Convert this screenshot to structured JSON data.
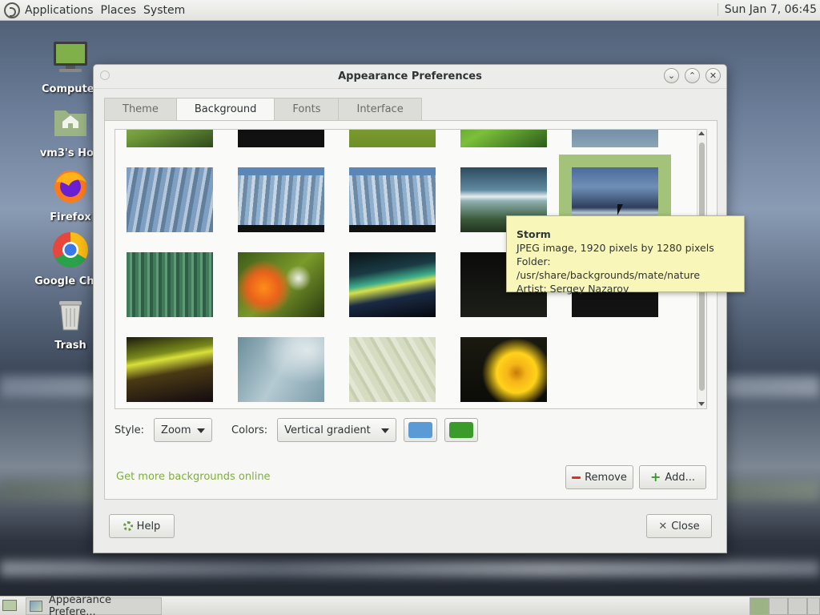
{
  "top_panel": {
    "menu": [
      "Applications",
      "Places",
      "System"
    ],
    "clock": "Sun Jan  7, 06:45"
  },
  "desktop_icons": [
    {
      "label": "Computer",
      "icon": "computer-icon"
    },
    {
      "label": "vm3's Hon",
      "icon": "home-folder-icon"
    },
    {
      "label": "Firefox",
      "icon": "firefox-icon"
    },
    {
      "label": "Google Chro",
      "icon": "chrome-icon"
    },
    {
      "label": "Trash",
      "icon": "trash-icon"
    }
  ],
  "window": {
    "title": "Appearance Preferences",
    "tabs": [
      {
        "label": "Theme",
        "active": false
      },
      {
        "label": "Background",
        "active": true
      },
      {
        "label": "Fonts",
        "active": false
      },
      {
        "label": "Interface",
        "active": false
      }
    ],
    "style_label": "Style:",
    "style_value": "Zoom",
    "colors_label": "Colors:",
    "colors_value": "Vertical gradient",
    "primary_color": "#5b9bd5",
    "secondary_color": "#3a9a2a",
    "more_link": "Get more backgrounds online",
    "remove_label": "Remove",
    "add_label": "Add...",
    "help_label": "Help",
    "close_label": "Close"
  },
  "tooltip": {
    "title": "Storm",
    "line1": "JPEG image, 1920 pixels by 1280 pixels",
    "line2": "Folder: /usr/share/backgrounds/mate/nature",
    "line3": "Artist: Sergey Nazarov"
  },
  "bottom_panel": {
    "task_label": "Appearance Prefere..."
  }
}
